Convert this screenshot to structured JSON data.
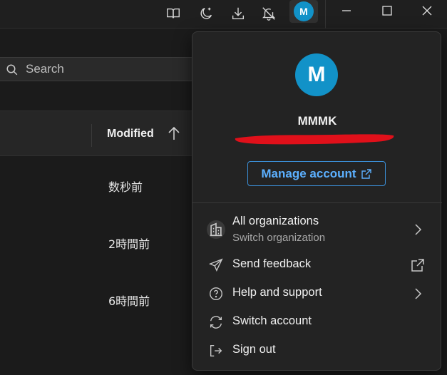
{
  "titlebar": {
    "icons": [
      "book-open-icon",
      "moon-sparkle-icon",
      "download-icon",
      "bell-off-icon"
    ],
    "avatar_initial": "M",
    "window_controls": [
      "minimize-icon",
      "maximize-icon",
      "close-icon"
    ]
  },
  "search": {
    "placeholder": "Search"
  },
  "table": {
    "column_header": "Modified",
    "sort_direction": "ascending",
    "rows": [
      {
        "modified": "数秒前"
      },
      {
        "modified": "2時間前"
      },
      {
        "modified": "6時間前"
      }
    ]
  },
  "account_menu": {
    "avatar_initial": "M",
    "user_name": "MMMK",
    "email_redacted": true,
    "manage_account_label": "Manage account",
    "items": [
      {
        "label": "All organizations",
        "sublabel": "Switch organization",
        "icon": "building-icon",
        "trailing": "chevron-right-icon"
      },
      {
        "label": "Send feedback",
        "icon": "paper-plane-icon",
        "trailing": "external-link-icon"
      },
      {
        "label": "Help and support",
        "icon": "question-circle-icon",
        "trailing": "chevron-right-icon"
      },
      {
        "label": "Switch account",
        "icon": "switch-arrows-icon"
      },
      {
        "label": "Sign out",
        "icon": "sign-out-icon"
      }
    ]
  },
  "colors": {
    "accent": "#1292c8",
    "link": "#5cb0ff",
    "background": "#1b1b1b",
    "flyout": "#232323",
    "redaction": "#e0101a"
  }
}
